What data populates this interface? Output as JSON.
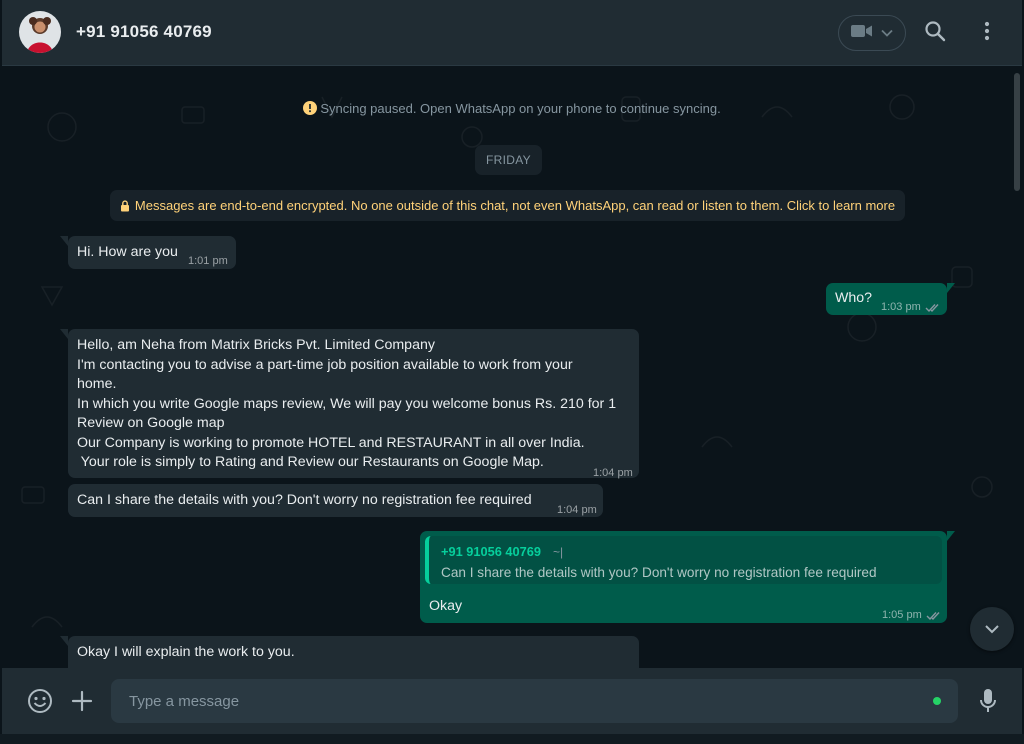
{
  "header": {
    "contact_name": "+91 91056 40769",
    "icons": [
      "video-camera-icon",
      "chevron-down-icon",
      "search-icon",
      "menu-dots-icon"
    ]
  },
  "system": {
    "sync_notice": "Syncing paused. Open WhatsApp on your phone to continue syncing.",
    "day_label": "FRIDAY",
    "encryption_notice": "Messages are end-to-end encrypted. No one outside of this chat, not even WhatsApp, can read or listen to them. Click to learn more"
  },
  "messages": [
    {
      "direction": "incoming",
      "text": "Hi. How are you",
      "time": "1:01 pm"
    },
    {
      "direction": "outgoing",
      "text": "Who?",
      "time": "1:03 pm",
      "status": "read"
    },
    {
      "direction": "incoming",
      "lines": [
        "Hello, am Neha from Matrix Bricks Pvt. Limited Company",
        "I'm contacting you to advise a part-time job position available to work from your",
        "home.",
        "In which you write Google maps review, We will pay you welcome bonus Rs. 210 for 1",
        "Review on Google map",
        "Our Company is working to promote HOTEL and RESTAURANT in all over India.",
        " Your role is simply to Rating and Review our Restaurants on Google Map."
      ],
      "time": "1:04 pm"
    },
    {
      "direction": "incoming",
      "text": "Can I share the details with you? Don't worry no registration fee required",
      "time": "1:04 pm"
    },
    {
      "direction": "outgoing",
      "quote": {
        "author": "+91 91056 40769",
        "extra": "~|",
        "text": "Can I share the details with you? Don't worry no registration fee required"
      },
      "text": "Okay",
      "time": "1:05 pm",
      "status": "read"
    },
    {
      "direction": "incoming",
      "lines": [
        "Okay I will explain the work to you."
      ],
      "time": ""
    }
  ],
  "composer": {
    "placeholder": "Type a message",
    "icons": [
      "emoji-icon",
      "attach-plus-icon",
      "microphone-icon"
    ]
  },
  "colors": {
    "header_bg": "#202c33",
    "chat_bg": "#0b141a",
    "incoming_bubble": "#202c33",
    "outgoing_bubble": "#005c4b",
    "accent_green": "#06cf9c",
    "notice_yellow": "#ffd279"
  }
}
